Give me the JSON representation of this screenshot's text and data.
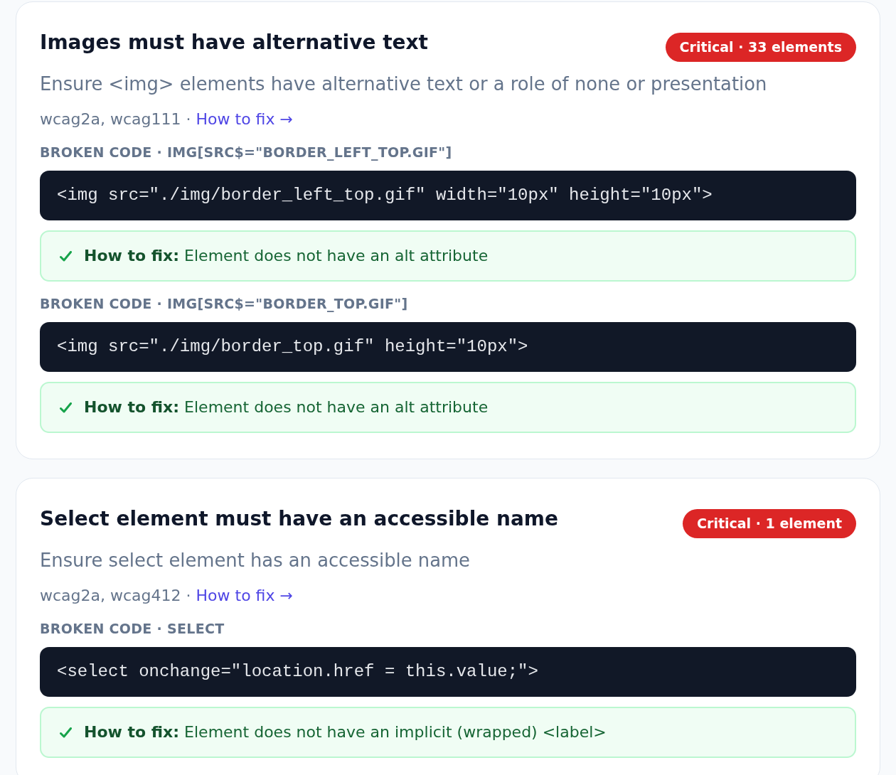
{
  "rules": [
    {
      "title": "Images must have alternative text",
      "badge": "Critical · 33 elements",
      "description": "Ensure <img> elements have alternative text or a role of none or presentation",
      "tags": "wcag2a, wcag111 ·",
      "link": "How to fix →",
      "instances": [
        {
          "label": "BROKEN CODE · IMG[SRC$=\"BORDER_LEFT_TOP.GIF\"]",
          "code": "<img src=\"./img/border_left_top.gif\" width=\"10px\" height=\"10px\">",
          "fix": "**How to fix:** Element does not have an alt attribute"
        },
        {
          "label": "BROKEN CODE · IMG[SRC$=\"BORDER_TOP.GIF\"]",
          "code": "<img src=\"./img/border_top.gif\" height=\"10px\">",
          "fix": "**How to fix:** Element does not have an alt attribute"
        }
      ]
    },
    {
      "title": "Select element must have an accessible name",
      "badge": "Critical · 1 element",
      "description": "Ensure select element has an accessible name",
      "tags": "wcag2a, wcag412 ·",
      "link": "How to fix →",
      "instances": [
        {
          "label": "BROKEN CODE · SELECT",
          "code": "<select onchange=\"location.href = this.value;\">",
          "fix": "**How to fix:** Element does not have an implicit (wrapped) <label>"
        }
      ]
    }
  ]
}
